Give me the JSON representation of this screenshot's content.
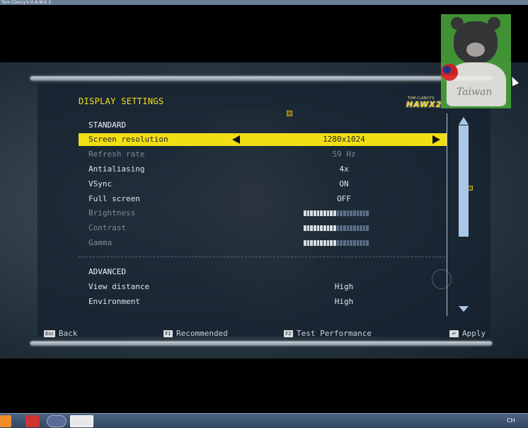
{
  "window": {
    "title": "Tom Clancy's H.A.W.X 2"
  },
  "header": {
    "title": "DISPLAY SETTINGS",
    "logo_small": "TOM CLANCY'S",
    "logo_big": "HAWX2"
  },
  "standard": {
    "heading": "STANDARD",
    "rows": [
      {
        "label": "Screen resolution",
        "value": "1280x1024"
      },
      {
        "label": "Refresh rate",
        "value": "59 Hz"
      },
      {
        "label": "Antialiasing",
        "value": "4x"
      },
      {
        "label": "VSync",
        "value": "ON"
      },
      {
        "label": "Full screen",
        "value": "OFF"
      },
      {
        "label": "Brightness",
        "value_fraction": 0.5
      },
      {
        "label": "Contrast",
        "value_fraction": 0.5
      },
      {
        "label": "Gamma",
        "value_fraction": 0.5
      }
    ]
  },
  "advanced": {
    "heading": "ADVANCED",
    "rows": [
      {
        "label": "View distance",
        "value": "High"
      },
      {
        "label": "Environment",
        "value": "High"
      }
    ]
  },
  "footer": {
    "back": {
      "key": "Esc",
      "label": "Back"
    },
    "recommended": {
      "key": "F1",
      "label": "Recommended"
    },
    "test": {
      "key": "F2",
      "label": "Test Performance"
    },
    "apply": {
      "key": "↵",
      "label": "Apply"
    }
  },
  "overlay": {
    "watermark_text": "Taiwan"
  },
  "taskbar": {
    "tray_text": "CH"
  },
  "colors": {
    "accent": "#f1df16",
    "panel": "#14202e",
    "slider_filled": "#d7dde4",
    "slider_empty": "#5b6e86"
  }
}
